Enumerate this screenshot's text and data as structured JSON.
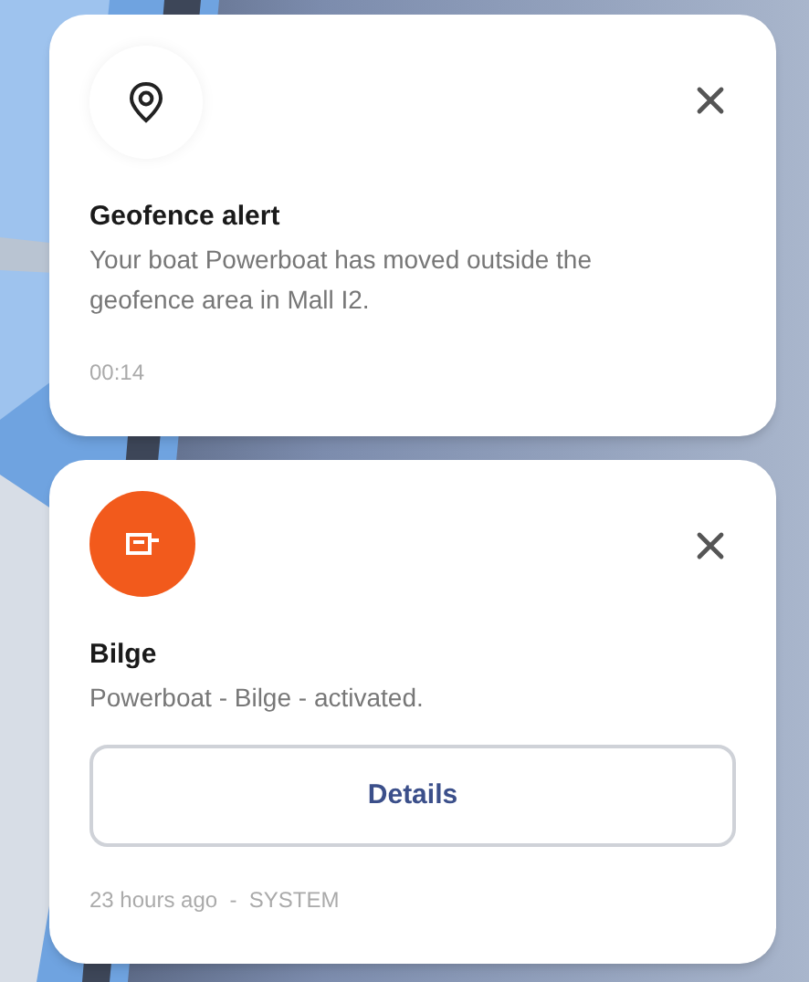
{
  "notifications": [
    {
      "kind": "geofence",
      "title": "Geofence alert",
      "message": "Your boat Powerboat has moved outside the geofence area in Mall I2.",
      "meta": "00:14"
    },
    {
      "kind": "alarm",
      "title": "Bilge",
      "message": "Powerboat - Bilge - activated.",
      "action": "Details",
      "meta": "23 hours ago  -  SYSTEM"
    }
  ]
}
